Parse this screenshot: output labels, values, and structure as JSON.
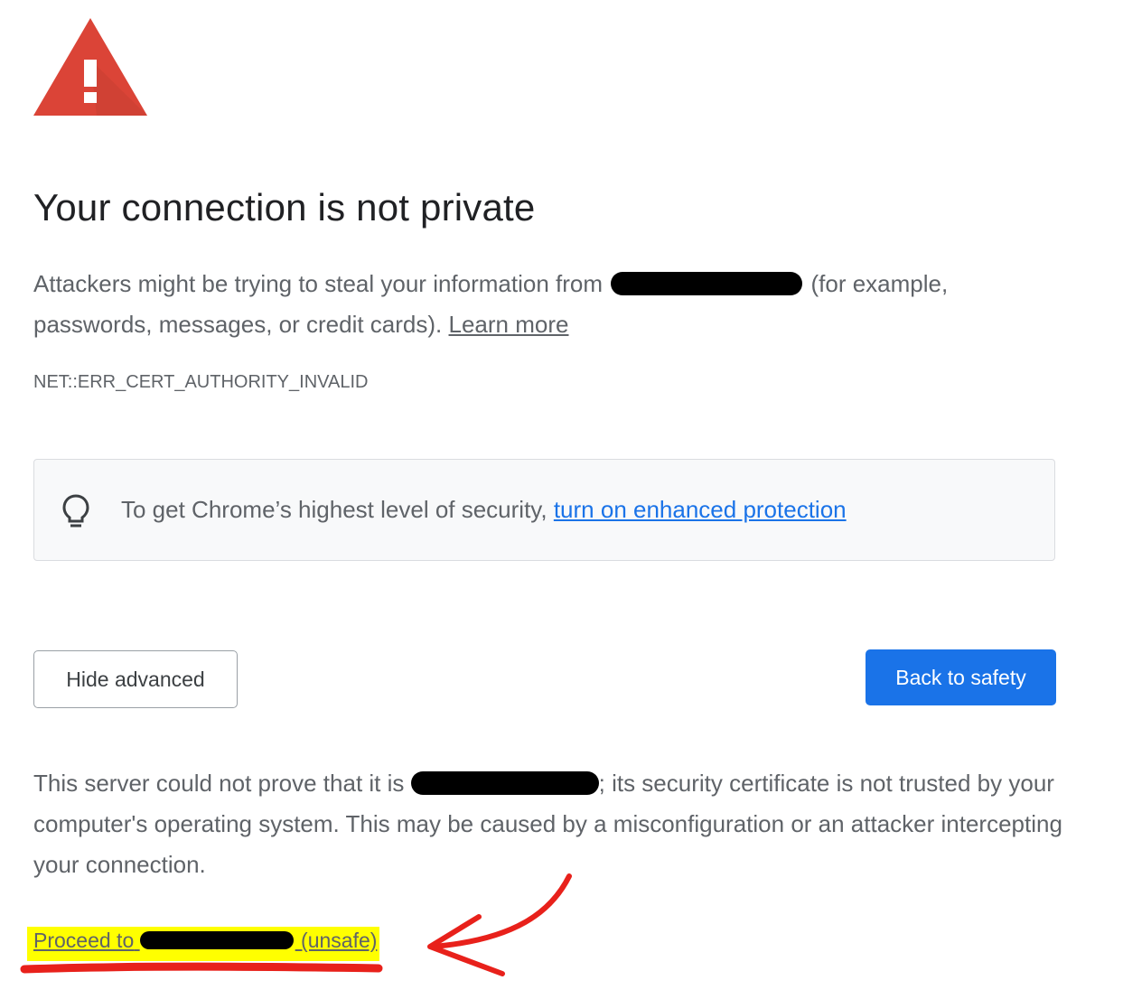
{
  "interstitial": {
    "headline": "Your connection is not private",
    "intro_before_host": "Attackers might be trying to steal your information from",
    "intro_after_host": "(for example, passwords, messages, or credit cards).",
    "learn_more_label": "Learn more",
    "error_code": "NET::ERR_CERT_AUTHORITY_INVALID",
    "icon": "warning-triangle-icon"
  },
  "promo": {
    "icon": "lightbulb-icon",
    "text": "To get Chrome’s highest level of security,",
    "link_label": "turn on enhanced protection"
  },
  "buttons": {
    "hide_advanced_label": "Hide advanced",
    "back_to_safety_label": "Back to safety"
  },
  "details": {
    "text_before_host": "This server could not prove that it is",
    "text_after_host": "; its security certificate is not trusted by your computer's operating system. This may be caused by a misconfiguration or an attacker intercepting your connection.",
    "proceed_prefix": "Proceed to",
    "proceed_suffix": "(unsafe)"
  },
  "colors": {
    "warning_red": "#db4437",
    "primary_blue": "#1a73e8",
    "text_gray": "#5f6368",
    "highlight_yellow": "#ffff00",
    "annotation_red": "#e8211b"
  }
}
